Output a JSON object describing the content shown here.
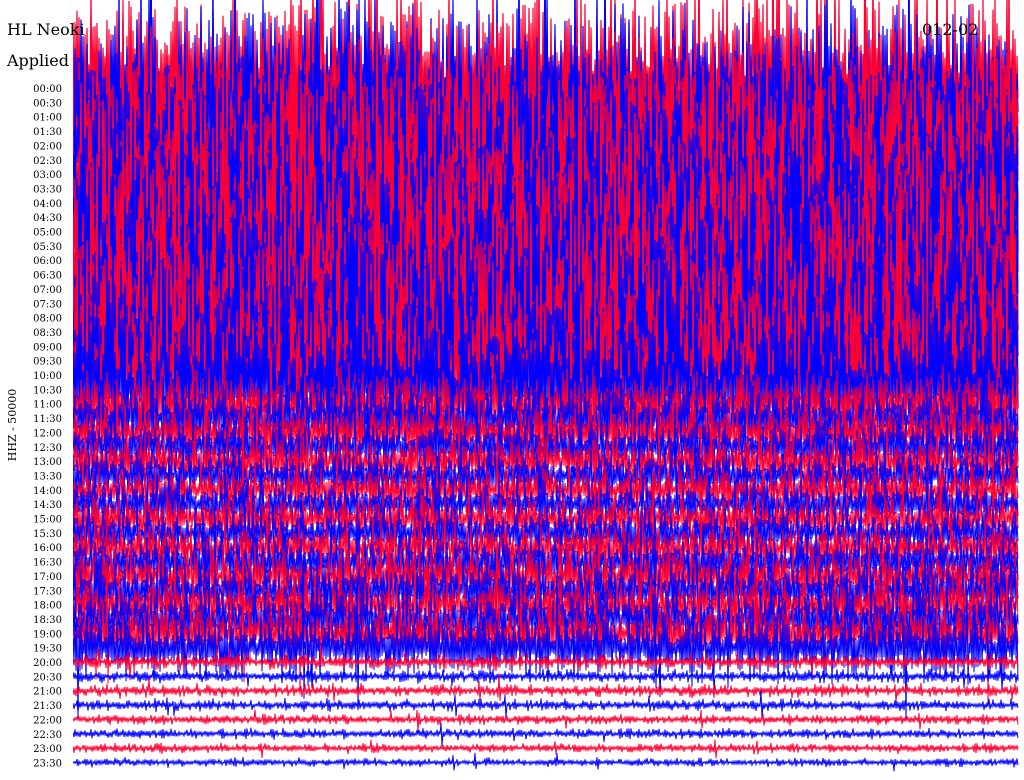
{
  "header": {
    "station_label": "HL Neoki",
    "filter_label": "Applied",
    "date_label": "012-02"
  },
  "chart_data": {
    "type": "line",
    "title": "HL Neoki",
    "subtitle": "Applied",
    "ylabel": "HHZ - 50000",
    "tick_labels": [
      "00:00",
      "00:30",
      "01:00",
      "01:30",
      "02:00",
      "02:30",
      "03:00",
      "03:30",
      "04:00",
      "04:30",
      "05:00",
      "05:30",
      "06:00",
      "06:30",
      "07:00",
      "07:30",
      "08:00",
      "08:30",
      "09:00",
      "09:30",
      "10:00",
      "10:30",
      "11:00",
      "11:30",
      "12:00",
      "12:30",
      "13:00",
      "13:30",
      "14:00",
      "14:30",
      "15:00",
      "15:30",
      "16:00",
      "16:30",
      "17:00",
      "17:30",
      "18:00",
      "18:30",
      "19:00",
      "19:30",
      "20:00",
      "20:30",
      "21:00",
      "21:30",
      "22:00",
      "22:30",
      "23:00",
      "23:30"
    ],
    "trace_colors": [
      "#ff0033",
      "#0000ff"
    ],
    "amplitude_level": [
      1.0,
      1.0,
      1.0,
      1.0,
      1.0,
      1.0,
      1.0,
      1.0,
      1.0,
      1.0,
      1.0,
      1.0,
      1.0,
      1.0,
      1.0,
      1.0,
      1.0,
      1.0,
      1.0,
      1.0,
      1.0,
      0.95,
      0.9,
      0.85,
      0.75,
      0.7,
      0.65,
      0.62,
      0.6,
      0.6,
      0.6,
      0.6,
      0.62,
      0.65,
      0.7,
      0.72,
      0.74,
      0.75,
      0.78,
      0.8,
      0.35,
      0.3,
      0.3,
      0.25,
      0.2,
      0.2,
      0.18,
      0.15
    ],
    "grid": false
  }
}
